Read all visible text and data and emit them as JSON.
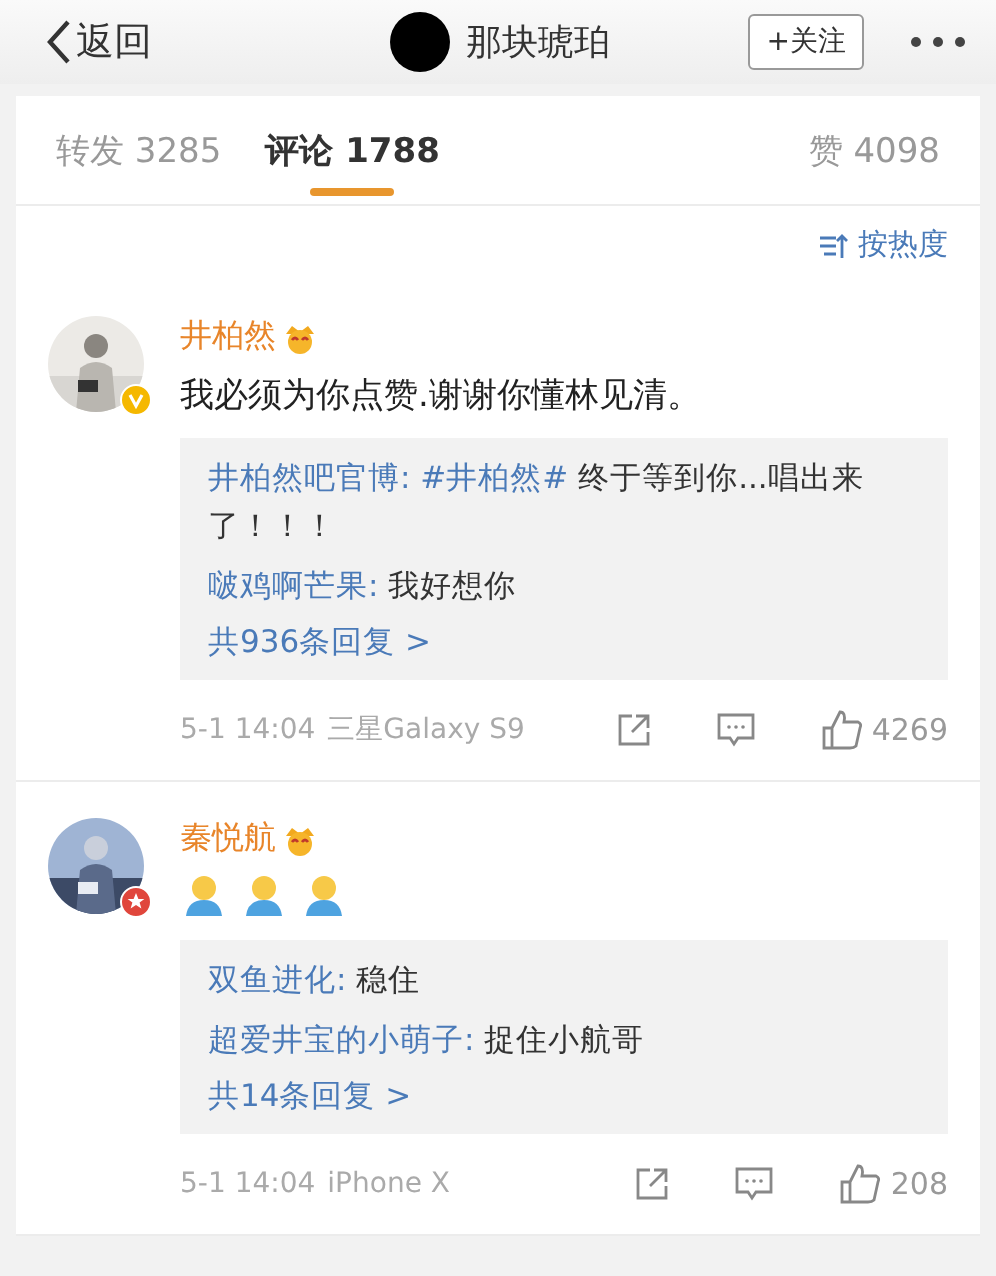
{
  "nav": {
    "back": "返回",
    "title": "那块琥珀",
    "follow": "+关注"
  },
  "tabs": [
    {
      "label": "转发 3285",
      "selected": false
    },
    {
      "label": "评论 1788",
      "selected": true
    },
    {
      "label": "赞 4098",
      "selected": false
    }
  ],
  "sort": "按热度",
  "comments": [
    {
      "name": "井柏然",
      "badge": {
        "kind": "verified"
      },
      "body": [
        {
          "kind": "text",
          "text": "我必须为你点赞.谢谢你懂林见清。"
        }
      ],
      "replies": [
        {
          "user": "井柏然吧官博:",
          "topic": "#井柏然#",
          "text": "终于等到你...唱出来了！！！"
        },
        {
          "user": "啵鸡啊芒果:",
          "text": "我好想你"
        }
      ],
      "more": "共936条回复 >",
      "time": "5-1 14:04",
      "device": "三星Galaxy S9",
      "likes": "4269"
    },
    {
      "name": "秦悦航",
      "badge": {
        "kind": "star"
      },
      "body": [
        {
          "kind": "emoji"
        },
        {
          "kind": "emoji"
        },
        {
          "kind": "emoji"
        }
      ],
      "replies": [
        {
          "user": "双鱼进化:",
          "text": "稳住"
        },
        {
          "user": "超爱井宝的小萌子:",
          "text": "捉住小航哥"
        }
      ],
      "more": "共14条回复 >",
      "time": "5-1 14:04",
      "device": "iPhone X",
      "likes": "208"
    }
  ]
}
